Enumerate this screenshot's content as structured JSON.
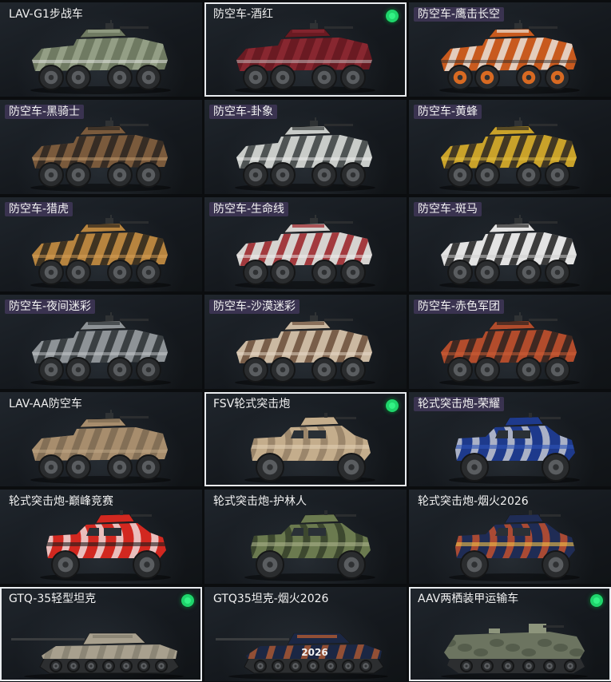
{
  "cards": [
    {
      "label": "LAV-G1步战车",
      "tag": false,
      "selected": false,
      "check": false,
      "type": "apc",
      "c1": "#6f7a62",
      "c2": "#9aa58c",
      "c3": "#e8e8e8",
      "wheel": "#2a2c2e",
      "rim": "#5a5d60"
    },
    {
      "label": "防空车-酒红",
      "tag": false,
      "selected": true,
      "check": true,
      "type": "apc",
      "c1": "#6a1a22",
      "c2": "#8d2a33",
      "c3": "#c8c8c8",
      "wheel": "#2a2c2e",
      "rim": "#5a5d60"
    },
    {
      "label": "防空车-鹰击长空",
      "tag": true,
      "selected": false,
      "check": false,
      "type": "apc",
      "c1": "#c85a1e",
      "c2": "#e9e2d9",
      "c3": "#2b2b2b",
      "wheel": "#2a2c2e",
      "rim": "#d86a22"
    },
    {
      "label": "防空车-黑骑士",
      "tag": true,
      "selected": false,
      "check": false,
      "type": "apc",
      "c1": "#7a5a3c",
      "c2": "#2a2420",
      "c3": "#c8a070",
      "wheel": "#2a2c2e",
      "rim": "#5a5d60"
    },
    {
      "label": "防空车-卦象",
      "tag": true,
      "selected": false,
      "check": false,
      "type": "apc",
      "c1": "#c9ccc9",
      "c2": "#3a3e3f",
      "c3": "#efefef",
      "wheel": "#2a2c2e",
      "rim": "#5a5d60"
    },
    {
      "label": "防空车-黄蜂",
      "tag": true,
      "selected": false,
      "check": false,
      "type": "apc",
      "c1": "#c9a22a",
      "c2": "#2a2622",
      "c3": "#e5c040",
      "wheel": "#2a2c2e",
      "rim": "#5a5d60"
    },
    {
      "label": "防空车-猎虎",
      "tag": true,
      "selected": false,
      "check": false,
      "type": "apc",
      "c1": "#b7843f",
      "c2": "#2a241c",
      "c3": "#d8a058",
      "wheel": "#2a2c2e",
      "rim": "#5a5d60"
    },
    {
      "label": "防空车-生命线",
      "tag": true,
      "selected": false,
      "check": false,
      "type": "apc",
      "c1": "#d6d3d0",
      "c2": "#9a1f25",
      "c3": "#f0eeee",
      "wheel": "#2a2c2e",
      "rim": "#5a5d60"
    },
    {
      "label": "防空车-斑马",
      "tag": true,
      "selected": false,
      "check": false,
      "type": "apc",
      "c1": "#e3e3e3",
      "c2": "#1f1f1f",
      "c3": "#cfcfcf",
      "wheel": "#2a2c2e",
      "rim": "#5a5d60"
    },
    {
      "label": "防空车-夜间迷彩",
      "tag": true,
      "selected": false,
      "check": false,
      "type": "apc",
      "c1": "#8e9397",
      "c2": "#2c3033",
      "c3": "#c7cbcd",
      "wheel": "#2a2c2e",
      "rim": "#5a5d60"
    },
    {
      "label": "防空车-沙漠迷彩",
      "tag": true,
      "selected": false,
      "check": false,
      "type": "apc",
      "c1": "#cbb9a2",
      "c2": "#6b4e3a",
      "c3": "#e9dccb",
      "wheel": "#2a2c2e",
      "rim": "#5a5d60"
    },
    {
      "label": "防空车-赤色军团",
      "tag": true,
      "selected": false,
      "check": false,
      "type": "apc",
      "c1": "#b24c2c",
      "c2": "#2a2220",
      "c3": "#d06038",
      "wheel": "#2a2c2e",
      "rim": "#5a5d60"
    },
    {
      "label": "LAV-AA防空车",
      "tag": false,
      "selected": false,
      "check": false,
      "type": "apc",
      "c1": "#a78d6d",
      "c2": "#7c6a52",
      "c3": "#c2a987",
      "wheel": "#2a2c2e",
      "rim": "#5a5d60"
    },
    {
      "label": "FSV轮式突击炮",
      "tag": false,
      "selected": true,
      "check": true,
      "type": "fsv",
      "c1": "#c4ad8c",
      "c2": "#8e7a60",
      "c3": "#e0cdb0",
      "wheel": "#2a2c2e",
      "rim": "#5a5d60"
    },
    {
      "label": "轮式突击炮-荣耀",
      "tag": true,
      "selected": false,
      "check": false,
      "type": "fsv",
      "c1": "#1e3a8c",
      "c2": "#d9d9d9",
      "c3": "#2d54b8",
      "wheel": "#2a2c2e",
      "rim": "#5a5d60"
    },
    {
      "label": "轮式突击炮-巅峰竞赛",
      "tag": false,
      "selected": false,
      "check": false,
      "type": "fsv",
      "c1": "#d22820",
      "c2": "#f2f2f2",
      "c3": "#1a1a1a",
      "wheel": "#2a2c2e",
      "rim": "#5a5d60"
    },
    {
      "label": "轮式突击炮-护林人",
      "tag": false,
      "selected": false,
      "check": false,
      "type": "fsv",
      "c1": "#6b7a4f",
      "c2": "#2e3824",
      "c3": "#a8b08a",
      "wheel": "#2a2c2e",
      "rim": "#5a5d60"
    },
    {
      "label": "轮式突击炮-烟火2026",
      "tag": false,
      "selected": false,
      "check": false,
      "type": "fsv",
      "c1": "#1f2c55",
      "c2": "#d8542a",
      "c3": "#f3c24a",
      "wheel": "#2a2c2e",
      "rim": "#5a5d60"
    },
    {
      "label": "GTQ-35轻型坦克",
      "tag": false,
      "selected": true,
      "check": true,
      "type": "tank",
      "c1": "#a8a08e",
      "c2": "#7a7466",
      "c3": "#c4bcaa",
      "wheel": "#2a2c2e",
      "rim": "#5a5d60"
    },
    {
      "label": "GTQ35坦克-烟火2026",
      "tag": false,
      "selected": false,
      "check": false,
      "type": "tank",
      "c1": "#1b2744",
      "c2": "#e36a2c",
      "c3": "#f2f2f2",
      "wheel": "#2a2c2e",
      "rim": "#5a5d60",
      "text": "2026"
    },
    {
      "label": "AAV两栖装甲运输车",
      "tag": false,
      "selected": true,
      "check": true,
      "type": "aav",
      "c1": "#6c7460",
      "c2": "#4c5444",
      "c3": "#8d957c",
      "wheel": "#2a2c2e",
      "rim": "#5a5d60"
    }
  ]
}
